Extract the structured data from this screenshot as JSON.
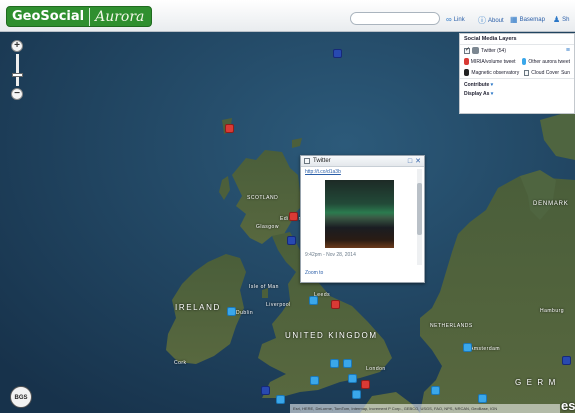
{
  "header": {
    "logo_brand": "GeoSocial",
    "logo_sub": "Aurora",
    "search_placeholder": "",
    "nav": [
      "Link",
      "About",
      "Basemap",
      "Sh"
    ]
  },
  "layers_panel": {
    "title": "Social Media Layers",
    "twitter_label": "Twitter (54)",
    "legend": [
      "MIRIA/volume tweet",
      "Other aurora tweet",
      "Magnetic observatory",
      "Cloud Cover",
      "Sun"
    ],
    "contribute": "Contribute",
    "display_as": "Display As"
  },
  "popup": {
    "title": "Twitter",
    "link_text": "http://t.co/d1a3b",
    "timestamp": "9:42pm - Nov 28, 2014",
    "zoom_to": "Zoom to"
  },
  "map_labels": {
    "ireland": "IRELAND",
    "uk": "UNITED KINGDOM",
    "denmark": "DENMARK",
    "netherlands": "NETHERLANDS",
    "germany": "G E R M",
    "scotland": "SCOTLAND",
    "glasgow": "Glasgow",
    "edinburgh": "Edinburgh",
    "dublin": "Dublin",
    "liverpool": "Liverpool",
    "isle_of_man": "Isle of Man",
    "leeds": "Leeds",
    "cork": "Cork",
    "london": "London",
    "hamburg": "Hamburg",
    "amsterdam": "Amsterdam"
  },
  "badge": "BGS",
  "attribution": "Esri, HERE, DeLorme, TomTom, Intermap, increment P Corp., GEBCO, USGS, FAO, NPS, NRCAN, GeoBase, IGN",
  "esri": "es",
  "colors": {
    "twitter": "#3aa7ea",
    "flagged": "#d93a35",
    "observatory": "#2849b0",
    "logo": "#2f8f2f"
  }
}
